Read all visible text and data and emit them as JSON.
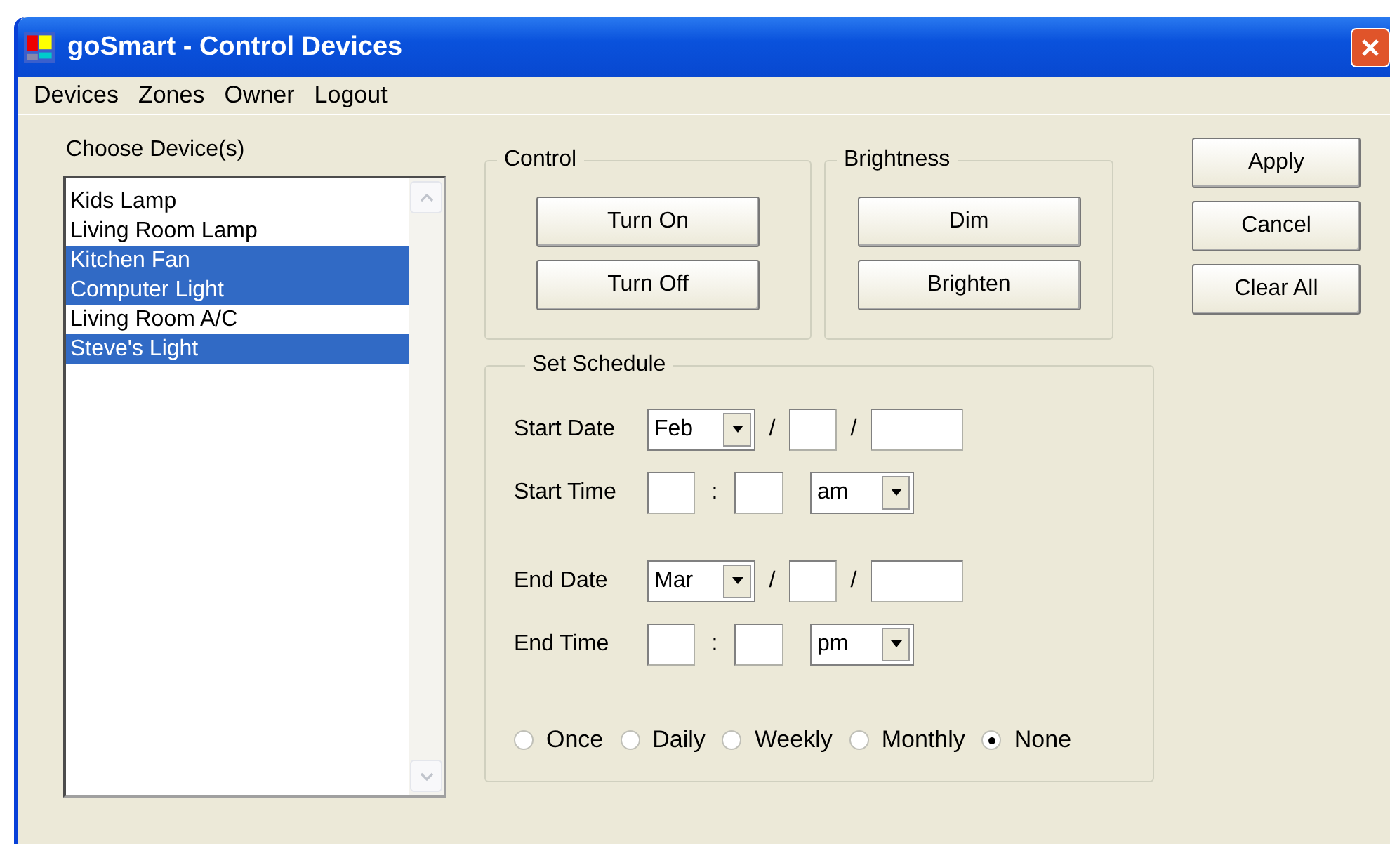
{
  "window": {
    "title": "goSmart - Control Devices"
  },
  "menu": [
    "Devices",
    "Zones",
    "Owner",
    "Logout"
  ],
  "device_list": {
    "label": "Choose Device(s)",
    "items": [
      {
        "label": "Kids Lamp",
        "selected": false
      },
      {
        "label": "Living Room Lamp",
        "selected": false
      },
      {
        "label": "Kitchen Fan",
        "selected": true
      },
      {
        "label": "Computer Light",
        "selected": true
      },
      {
        "label": "Living Room A/C",
        "selected": false
      },
      {
        "label": "Steve's Light",
        "selected": true
      }
    ]
  },
  "control": {
    "title": "Control",
    "buttons": [
      "Turn On",
      "Turn Off"
    ]
  },
  "brightness": {
    "title": "Brightness",
    "buttons": [
      "Dim",
      "Brighten"
    ]
  },
  "actions": [
    "Apply",
    "Cancel",
    "Clear All"
  ],
  "schedule": {
    "title": "Set Schedule",
    "rows": [
      {
        "kind": "date",
        "label": "Start Date",
        "month": "Feb",
        "separators": [
          "/",
          "/"
        ]
      },
      {
        "kind": "time",
        "label": "Start Time",
        "separator": ":",
        "period": "am"
      },
      {
        "kind": "date",
        "label": "End Date",
        "month": "Mar",
        "separators": [
          "/",
          "/"
        ]
      },
      {
        "kind": "time",
        "label": "End Time",
        "separator": ":",
        "period": "pm"
      }
    ],
    "recurrence": [
      {
        "label": "Once",
        "selected": false
      },
      {
        "label": "Daily",
        "selected": false
      },
      {
        "label": "Weekly",
        "selected": false
      },
      {
        "label": "Monthly",
        "selected": false
      },
      {
        "label": "None",
        "selected": true
      }
    ]
  }
}
